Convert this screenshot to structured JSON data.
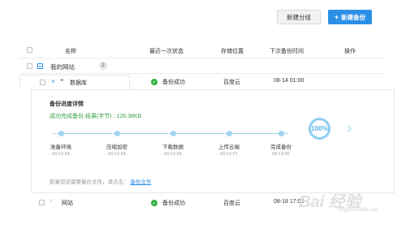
{
  "toolbar": {
    "new_group_label": "新建分组",
    "new_backup_label": "新建备份"
  },
  "table": {
    "headers": {
      "name": "名称",
      "last_status": "最近一次状态",
      "location": "存储位置",
      "next_backup_time": "下次备份时间",
      "actions": "操作"
    }
  },
  "group": {
    "name": "我的网站",
    "count": "2"
  },
  "rows": [
    {
      "name": "数据库",
      "status": "备份成功",
      "location": "百度云",
      "next_time": "08-14 01:00"
    },
    {
      "name": "网站",
      "status": "备份成功",
      "location": "百度云",
      "next_time": "08-18 17:00"
    }
  ],
  "detail": {
    "title": "备份进度详情",
    "result": "成功完成备份,结果(字节) : 126.38KB",
    "progress_text": "100%",
    "progress": 1.0,
    "steps": [
      {
        "label": "准备环境",
        "time": "00:12:54"
      },
      {
        "label": "压缩加密",
        "time": "00:12:54"
      },
      {
        "label": "下载数据",
        "time": "00:12:55"
      },
      {
        "label": "上传云端",
        "time": "00:12:57"
      },
      {
        "label": "完成备份",
        "time": "00:13:00"
      }
    ],
    "footer_text": "如果您还需要备份文件，请点击：",
    "footer_link": "备份文件"
  },
  "watermark": {
    "main": "Bai 经验",
    "sub": "jingyan.baidu.com"
  },
  "colors": {
    "accent": "#2b8fe6",
    "success": "#2fb344",
    "progress": "#8ccff2"
  }
}
